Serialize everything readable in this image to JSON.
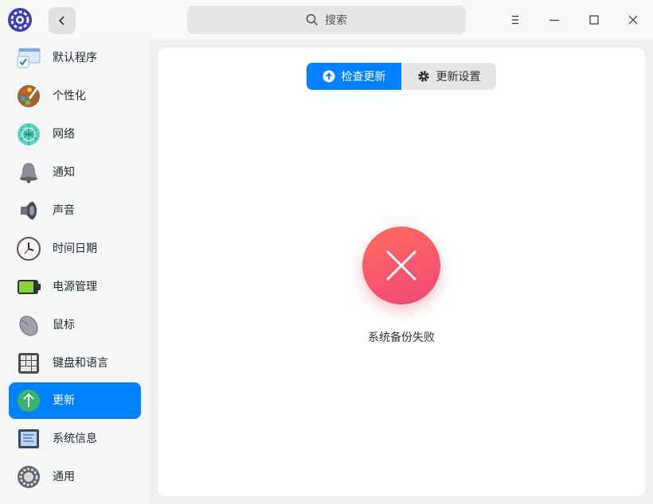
{
  "search": {
    "label": "搜索"
  },
  "sidebar": {
    "items": [
      {
        "label": "默认程序",
        "icon": "default-apps-icon"
      },
      {
        "label": "个性化",
        "icon": "palette-icon"
      },
      {
        "label": "网络",
        "icon": "network-icon"
      },
      {
        "label": "通知",
        "icon": "bell-icon"
      },
      {
        "label": "声音",
        "icon": "speaker-icon"
      },
      {
        "label": "时间日期",
        "icon": "clock-icon"
      },
      {
        "label": "电源管理",
        "icon": "battery-icon"
      },
      {
        "label": "鼠标",
        "icon": "mouse-icon"
      },
      {
        "label": "键盘和语言",
        "icon": "keyboard-icon"
      },
      {
        "label": "更新",
        "icon": "update-icon",
        "active": true
      },
      {
        "label": "系统信息",
        "icon": "system-info-icon"
      },
      {
        "label": "通用",
        "icon": "general-icon"
      }
    ]
  },
  "tabs": {
    "check_update": "检查更新",
    "update_settings": "更新设置"
  },
  "status": {
    "message": "系统备份失败"
  },
  "colors": {
    "accent": "#0081ff",
    "error": "#f25a6b"
  }
}
